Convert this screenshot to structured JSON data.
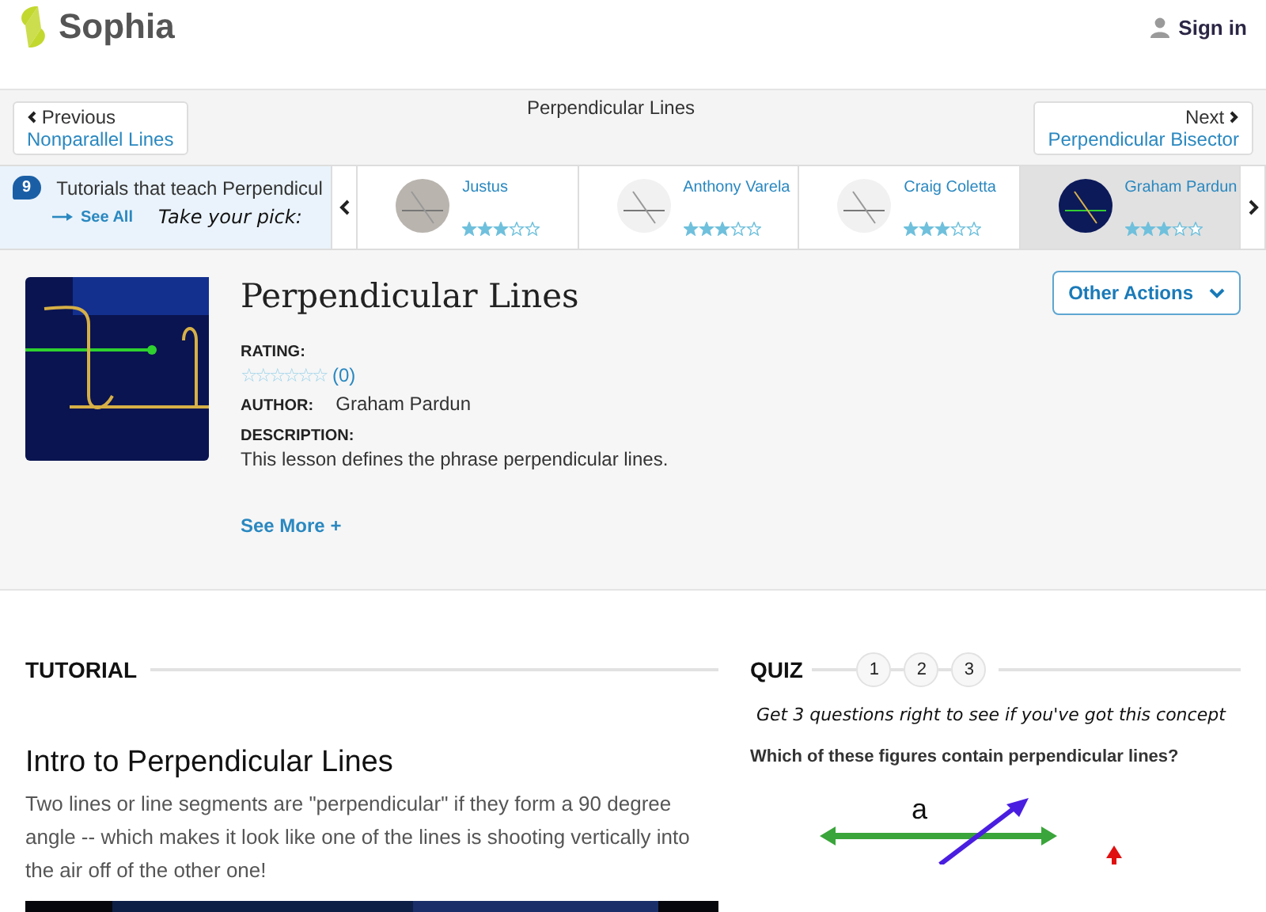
{
  "header": {
    "logo": "Sophia",
    "sign_in": "Sign in"
  },
  "nav": {
    "previous": {
      "label": "Previous",
      "title": "Nonparallel Lines"
    },
    "current": "Perpendicular Lines",
    "next": {
      "label": "Next",
      "title": "Perpendicular Bisector"
    }
  },
  "carousel": {
    "count": "9",
    "heading": "Tutorials that teach Perpendicul",
    "see_all": "See All",
    "tagline": "Take your pick:",
    "cards": [
      {
        "author": "Justus",
        "stars": 3,
        "selected": false
      },
      {
        "author": "Anthony Varela",
        "stars": 3,
        "selected": false
      },
      {
        "author": "Craig Coletta",
        "stars": 3,
        "selected": false
      },
      {
        "author": "Graham Pardun",
        "stars": 3,
        "selected": true
      }
    ]
  },
  "lesson": {
    "title": "Perpendicular Lines",
    "rating_label": "RATING:",
    "stars": 0,
    "rating_count": "(0)",
    "author_label": "AUTHOR:",
    "author": "Graham Pardun",
    "description_label": "DESCRIPTION:",
    "description": "This lesson defines the phrase perpendicular lines.",
    "see_more": "See More +",
    "actions": "Other Actions"
  },
  "tutorial": {
    "heading": "TUTORIAL",
    "title": "Intro to Perpendicular Lines",
    "body": "Two lines or line segments are \"perpendicular\" if they form a 90 degree angle -- which makes it look like one of the lines is shooting vertically into the air off of the other one!"
  },
  "quiz": {
    "heading": "QUIZ",
    "steps": [
      "1",
      "2",
      "3"
    ],
    "prompt": "Get 3 questions right to see if you've got this concept",
    "question": "Which of these figures contain perpendicular lines?",
    "figure_label": "a"
  }
}
